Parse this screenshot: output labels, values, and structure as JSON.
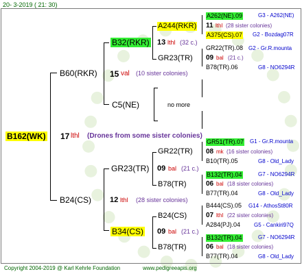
{
  "date": "20- 3-2019 ( 21: 30)",
  "footer_left": "Copyright 2004-2019 @ Karl Kehrle Foundation",
  "footer_right": "www.pedigreeapis.org",
  "root": {
    "name": "B162(WK)",
    "mid": "17",
    "mid_code": "lthl",
    "mid_text": "(Drones from some sister colonies)"
  },
  "b60": {
    "name": "B60(RKR)",
    "mid": "15",
    "mid_code": "val",
    "mid_text": "(10 sister colonies)"
  },
  "b32": {
    "name": "B32(RKR)",
    "mid": "13",
    "mid_code": "lthl",
    "mid_text": "(32 c.)"
  },
  "a244": {
    "name": "A244(RKR)",
    "num": "11",
    "code": "lthl",
    "text": "(28 sister colonies)"
  },
  "a262": {
    "name": "A262(NE).09",
    "right": "G3 - A262(NE)"
  },
  "a375": {
    "name": "A375(CS).07",
    "right": "G2 - Bozdag07R"
  },
  "gr23a": {
    "name": "GR23(TR)",
    "num": "09",
    "code": "bal",
    "text": "(21 c.)"
  },
  "gr22a": {
    "name": "GR22(TR).08",
    "right": "G2 - Gr.R.mounta"
  },
  "b78a": {
    "name": "B78(TR).06",
    "right": "G8 - NO6294R"
  },
  "c5": {
    "name": "C5(NE)",
    "more": "no more"
  },
  "b24": {
    "name": "B24(CS)",
    "mid": "12",
    "mid_code": "lthl",
    "mid_text": "(28 sister colonies)"
  },
  "gr23b": {
    "name": "GR23(TR)",
    "mid": "09",
    "mid_code": "bal",
    "mid_text": "(21 c.)"
  },
  "gr22b": {
    "name": "GR22(TR)",
    "num": "08",
    "code": "mk",
    "text": "(16 sister colonies)"
  },
  "gr51": {
    "name": "GR51(TR).07",
    "right": "G1 - Gr.R.mounta"
  },
  "b10": {
    "name": "B10(TR).05",
    "right": "G8 - Old_Lady"
  },
  "b78b": {
    "name": "B78(TR)",
    "num": "06",
    "code": "bal",
    "text": "(18 sister colonies)"
  },
  "b132a": {
    "name": "B132(TR).04",
    "right": "G7 - NO6294R"
  },
  "b77a": {
    "name": "B77(TR).04",
    "right": "G8 - Old_Lady"
  },
  "b34": {
    "name": "B34(CS)",
    "mid": "09",
    "mid_code": "bal",
    "mid_text": "(21 c.)"
  },
  "b24c": {
    "name": "B24(CS)",
    "num": "07",
    "code": "lthl",
    "text": "(22 sister colonies)"
  },
  "b444": {
    "name": "B444(CS).05",
    "right": "G14 - AthosSt80R"
  },
  "a284": {
    "name": "A284(PJ).04",
    "right": "G5 - Cankiri97Q"
  },
  "b78c": {
    "name": "B78(TR)",
    "num": "06",
    "code": "bal",
    "text": "(18 sister colonies)"
  },
  "b132b": {
    "name": "B132(TR).04",
    "right": "G7 - NO6294R"
  },
  "b77b": {
    "name": "B77(TR).04",
    "right": "G8 - Old_Lady"
  }
}
